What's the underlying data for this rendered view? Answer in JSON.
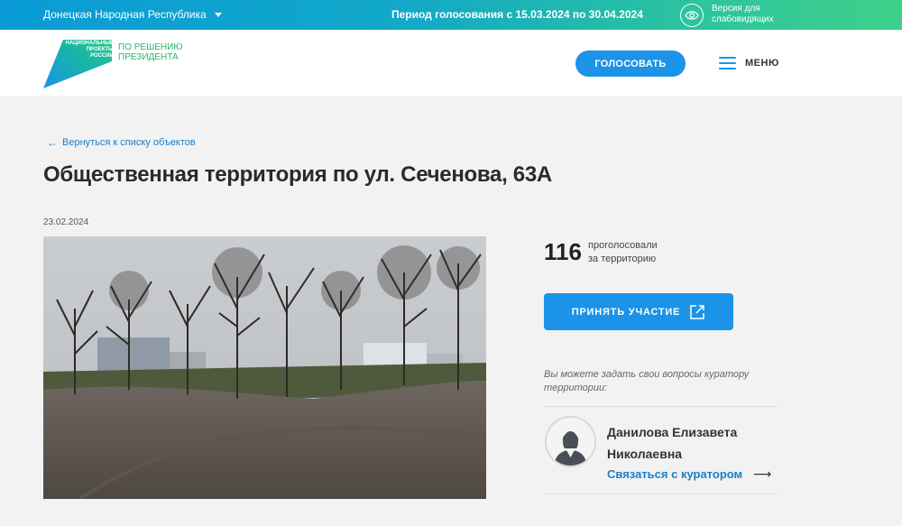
{
  "topbar": {
    "region": "Донецкая Народная Республика",
    "period": "Период голосования с 15.03.2024 по 30.04.2024",
    "vision_line1": "Версия для",
    "vision_line2": "слабовидящих"
  },
  "header": {
    "logo_line1": "НАЦИОНАЛЬНЫЕ",
    "logo_line2": "ПРОЕКТЫ",
    "logo_line3": "РОССИИ",
    "slogan_line1": "ПО РЕШЕНИЮ",
    "slogan_line2": "ПРЕЗИДЕНТА",
    "vote_label": "ГОЛОСОВАТЬ",
    "menu_label": "МЕНЮ"
  },
  "main": {
    "back_label": "Вернуться к списку объектов",
    "title": "Общественная территория по ул. Сеченова, 63А",
    "date": "23.02.2024"
  },
  "sidebar": {
    "votes_count": "116",
    "votes_label_line1": "проголосовали",
    "votes_label_line2": "за территорию",
    "join_label": "ПРИНЯТЬ УЧАСТИЕ",
    "question": "Вы можете задать свои вопросы куратору территории:",
    "curator_name_line1": "Данилова Елизавета",
    "curator_name_line2": "Николаевна",
    "contact_label": "Связаться с куратором"
  },
  "colors": {
    "accent": "#1a93e8",
    "link": "#1a7fc8",
    "gradient_start": "#0a9bd6",
    "gradient_end": "#3fd08a"
  },
  "icons": [
    "chevron-down-icon",
    "eye-icon",
    "menu-icon",
    "arrow-left-icon",
    "external-link-icon",
    "avatar-icon",
    "arrow-right-icon"
  ]
}
